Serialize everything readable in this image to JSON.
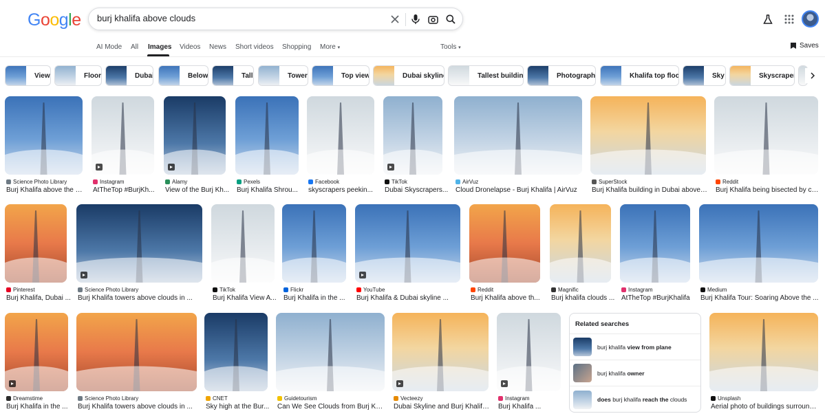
{
  "logo": "Google",
  "search": {
    "query": "burj khalifa above clouds"
  },
  "tabs": [
    "AI Mode",
    "All",
    "Images",
    "Videos",
    "News",
    "Short videos",
    "Shopping",
    "More",
    "Tools"
  ],
  "saves_label": "Saves",
  "chips": [
    "View",
    "Floor",
    "Dubai",
    "Below",
    "Tall",
    "Tower",
    "Top view",
    "Dubai skyline",
    "Tallest building",
    "Photography",
    "Khalifa top floor",
    "Sky",
    "Skyscraper"
  ],
  "results": [
    {
      "source": "Science Photo Library",
      "title": "Burj Khalifa above the cl...",
      "video": false
    },
    {
      "source": "Instagram",
      "title": "AtTheTop #BurjKh...",
      "video": true
    },
    {
      "source": "Alamy",
      "title": "View of the Burj Kh...",
      "video": true
    },
    {
      "source": "Pexels",
      "title": "Burj Khalifa Shrou...",
      "video": false
    },
    {
      "source": "Facebook",
      "title": "skyscrapers peekin...",
      "video": false
    },
    {
      "source": "TikTok",
      "title": "Dubai Skyscrapers...",
      "video": true
    },
    {
      "source": "AirVuz",
      "title": "Cloud Dronelapse - Burj Khalifa | AirVuz",
      "video": false
    },
    {
      "source": "SuperStock",
      "title": "Burj Khalifa building in Dubai above ...",
      "video": false
    },
    {
      "source": "Reddit",
      "title": "Burj Khalifa being bisected by clo...",
      "video": false
    },
    {
      "source": "Pinterest",
      "title": "Burj Khalifa, Dubai ...",
      "video": false
    },
    {
      "source": "Science Photo Library",
      "title": "Burj Khalifa towers above clouds in ...",
      "video": true
    },
    {
      "source": "TikTok",
      "title": "Burj Khalifa View A...",
      "video": false
    },
    {
      "source": "Flickr",
      "title": "Burj Khalifa in the ...",
      "video": false
    },
    {
      "source": "YouTube",
      "title": "Burj Khalifa & Dubai skyline ...",
      "video": true
    },
    {
      "source": "Reddit",
      "title": "Burj Khalifa above th...",
      "video": false
    },
    {
      "source": "Magnific",
      "title": "Burj khalifa clouds ...",
      "video": false
    },
    {
      "source": "Instagram",
      "title": "AtTheTop #BurjKhalifa",
      "video": false
    },
    {
      "source": "Medium",
      "title": "Burj Khalifa Tour: Soaring Above the ...",
      "video": false
    },
    {
      "source": "Dreamstime",
      "title": "Burj Khalifa in the ...",
      "video": true
    },
    {
      "source": "Science Photo Library",
      "title": "Burj Khalifa towers above clouds in ...",
      "video": false
    },
    {
      "source": "CNET",
      "title": "Sky high at the Bur...",
      "video": false
    },
    {
      "source": "Guidetourism",
      "title": "Can We See Clouds from Burj Kha...",
      "video": false
    },
    {
      "source": "Vecteezy",
      "title": "Dubai Skyline and Burj Khalifa...",
      "video": true
    },
    {
      "source": "Instagram",
      "title": "Burj Khalifa ...",
      "video": true
    },
    {
      "source": "Unsplash",
      "title": "Aerial photo of buildings surrounde...",
      "video": false
    }
  ],
  "related": {
    "heading": "Related searches",
    "items": [
      {
        "pre": "burj khalifa ",
        "bold": "view from plane",
        "post": ""
      },
      {
        "pre": "burj khalifa ",
        "bold": "owner",
        "post": ""
      },
      {
        "pre": "",
        "bold": "does",
        "mid": " burj khalifa ",
        "bold2": "reach the",
        "post": " clouds"
      }
    ]
  }
}
